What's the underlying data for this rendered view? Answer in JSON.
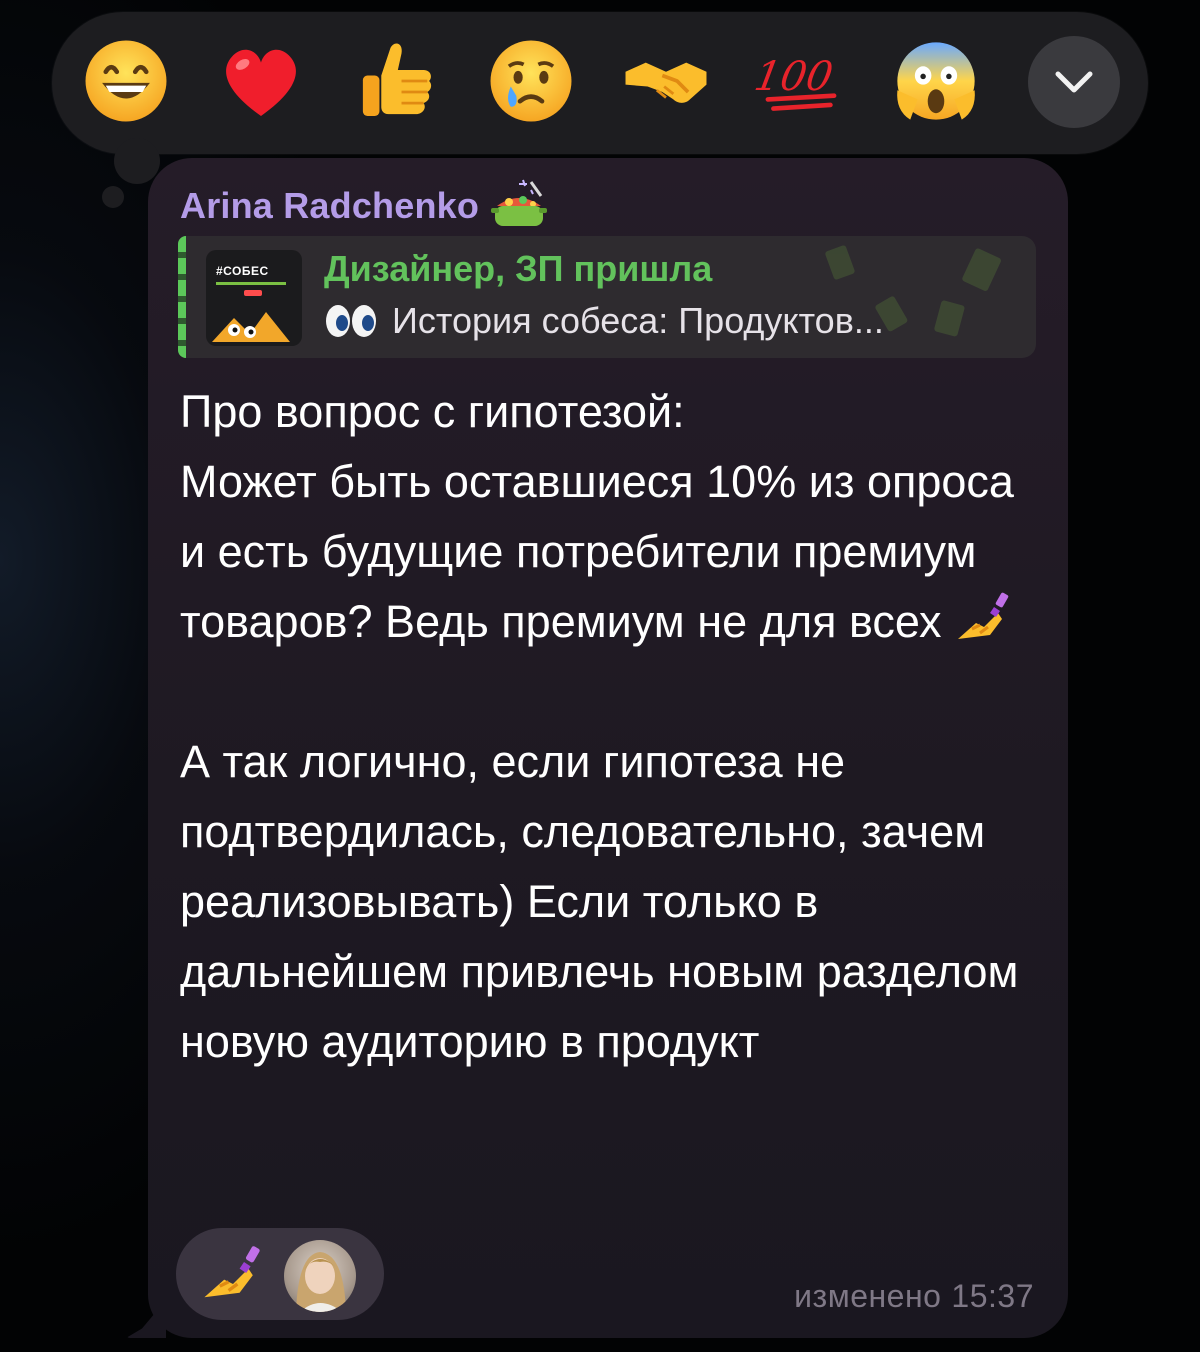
{
  "reaction_picker": {
    "reactions": [
      {
        "icon": "grinning-face-emoji"
      },
      {
        "icon": "red-heart-emoji"
      },
      {
        "icon": "thumbs-up-emoji"
      },
      {
        "icon": "crying-face-emoji"
      },
      {
        "icon": "handshake-emoji"
      },
      {
        "icon": "hundred-points-emoji"
      },
      {
        "icon": "screaming-face-emoji"
      }
    ],
    "expand_icon": "chevron-down-icon"
  },
  "message": {
    "sender": "Arina Radchenko",
    "sender_badge_icon": "cooking-pot-emoji",
    "reply": {
      "thumb_label": "#СОБЕС",
      "title": "Дизайнер, ЗП пришла",
      "subtitle_icon": "eyes-emoji",
      "subtitle": "История собеса: Продуктов..."
    },
    "paragraphs": [
      "Про вопрос с гипотезой:\nМожет быть оставшиеся 10% из опроса и есть будущие потребители премиум товаров? Ведь премиум не для всех",
      "А так логично, если гипотеза не подтвердилась, следовательно, зачем реализовывать) Если только в дальнейшем привлечь новым разделом новую аудиторию в продукт"
    ],
    "inline_emoji": "nail-polish-emoji",
    "reaction": {
      "icon": "nail-polish-emoji",
      "reactor": "avatar"
    },
    "edited_label": "изменено",
    "time": "15:37"
  }
}
